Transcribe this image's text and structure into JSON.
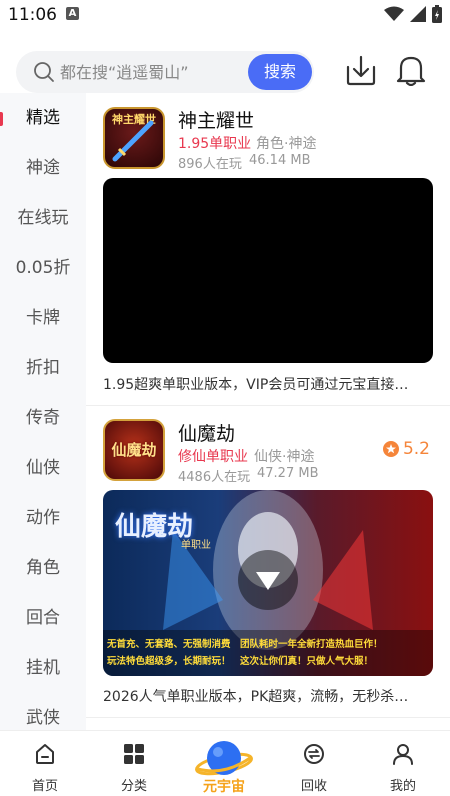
{
  "status": {
    "time": "11:06",
    "notif": "A"
  },
  "search": {
    "placeholder": "都在搜“逍遥蜀山”",
    "button": "搜索"
  },
  "sidebar": {
    "items": [
      {
        "label": "精选"
      },
      {
        "label": "神途"
      },
      {
        "label": "在线玩"
      },
      {
        "label": "0.05折"
      },
      {
        "label": "卡牌"
      },
      {
        "label": "折扣"
      },
      {
        "label": "传奇"
      },
      {
        "label": "仙侠"
      },
      {
        "label": "动作"
      },
      {
        "label": "角色"
      },
      {
        "label": "回合"
      },
      {
        "label": "挂机"
      },
      {
        "label": "武侠"
      }
    ],
    "active_index": 0
  },
  "games": [
    {
      "name": "神主耀世",
      "icon_text": "神主耀世",
      "tag_primary": "1.95单职业",
      "tag_secondary": "角色·神途",
      "players": "896人在玩",
      "size": "46.14 MB",
      "description": "1.95超爽单职业版本，VIP会员可通过元宝直接…"
    },
    {
      "name": "仙魔劫",
      "icon_text": "仙魔劫",
      "tag_primary": "修仙单职业",
      "tag_secondary": "仙侠·神途",
      "players": "4486人在玩",
      "size": "47.27 MB",
      "rating": "5.2",
      "banner_title": "仙魔劫",
      "banner_subtitle": "单职业",
      "banner_line1": "无首充、无套路、无强制消费　团队耗时一年全新打造热血巨作！",
      "banner_line2": "玩法特色超级多，长期耐玩！　这次让你们真！只做人气大服！",
      "description": "2026人气单职业版本，PK超爽，流畅，无秒杀…"
    }
  ],
  "bottom_nav": {
    "items": [
      {
        "label": "首页",
        "icon": "home-icon"
      },
      {
        "label": "分类",
        "icon": "grid-icon"
      },
      {
        "label": "元宇宙",
        "icon": "planet-logo"
      },
      {
        "label": "回收",
        "icon": "recycle-icon"
      },
      {
        "label": "我的",
        "icon": "user-icon"
      }
    ]
  },
  "colors": {
    "accent": "#4a6cf6",
    "tag_red": "#e8384f",
    "rating_orange": "#f5853a"
  }
}
